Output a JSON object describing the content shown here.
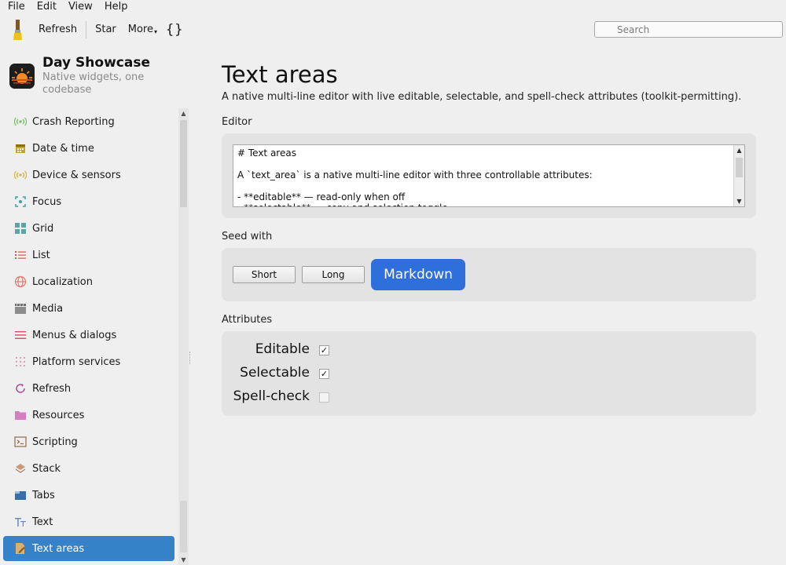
{
  "menubar": {
    "items": [
      "File",
      "Edit",
      "View",
      "Help"
    ]
  },
  "toolbar": {
    "refresh_label": "Refresh",
    "star_label": "Star",
    "more_label": "More",
    "braces_label": "{}",
    "search_placeholder": "Search"
  },
  "brand": {
    "title": "Day Showcase",
    "subtitle": "Native widgets, one codebase"
  },
  "sidebar": {
    "items": [
      {
        "label": "Crash Reporting",
        "icon": "broadcast-icon"
      },
      {
        "label": "Date & time",
        "icon": "calendar-icon"
      },
      {
        "label": "Device & sensors",
        "icon": "sensor-icon"
      },
      {
        "label": "Focus",
        "icon": "focus-icon"
      },
      {
        "label": "Grid",
        "icon": "grid-icon"
      },
      {
        "label": "List",
        "icon": "list-icon"
      },
      {
        "label": "Localization",
        "icon": "globe-icon"
      },
      {
        "label": "Media",
        "icon": "clapperboard-icon"
      },
      {
        "label": "Menus & dialogs",
        "icon": "menu-icon"
      },
      {
        "label": "Platform services",
        "icon": "dots-grid-icon"
      },
      {
        "label": "Refresh",
        "icon": "refresh-icon"
      },
      {
        "label": "Resources",
        "icon": "folder-icon"
      },
      {
        "label": "Scripting",
        "icon": "terminal-icon"
      },
      {
        "label": "Stack",
        "icon": "layers-icon"
      },
      {
        "label": "Tabs",
        "icon": "tabs-icon"
      },
      {
        "label": "Text",
        "icon": "text-icon"
      },
      {
        "label": "Text areas",
        "icon": "document-edit-icon",
        "active": true
      }
    ]
  },
  "main": {
    "title": "Text areas",
    "subtitle": "A native multi-line editor with live editable, selectable, and spell-check attributes (toolkit-permitting).",
    "editor_label": "Editor",
    "editor_text": "# Text areas\n\nA `text_area` is a native multi-line editor with three controllable attributes:\n\n- **editable** — read-only when off\n- **selectable** — copy and selection toggle",
    "seed_label": "Seed with",
    "seed_buttons": {
      "short": "Short",
      "long": "Long",
      "markdown": "Markdown"
    },
    "attributes_label": "Attributes",
    "attributes": [
      {
        "label": "Editable",
        "checked": true,
        "mark": "✓"
      },
      {
        "label": "Selectable",
        "checked": true,
        "mark": "✓"
      },
      {
        "label": "Spell-check",
        "checked": false,
        "mark": ""
      }
    ]
  },
  "colors": {
    "accent": "#3582c9",
    "primary_button": "#2f6fdc",
    "card": "#e3e3e3",
    "background": "#efefef"
  }
}
